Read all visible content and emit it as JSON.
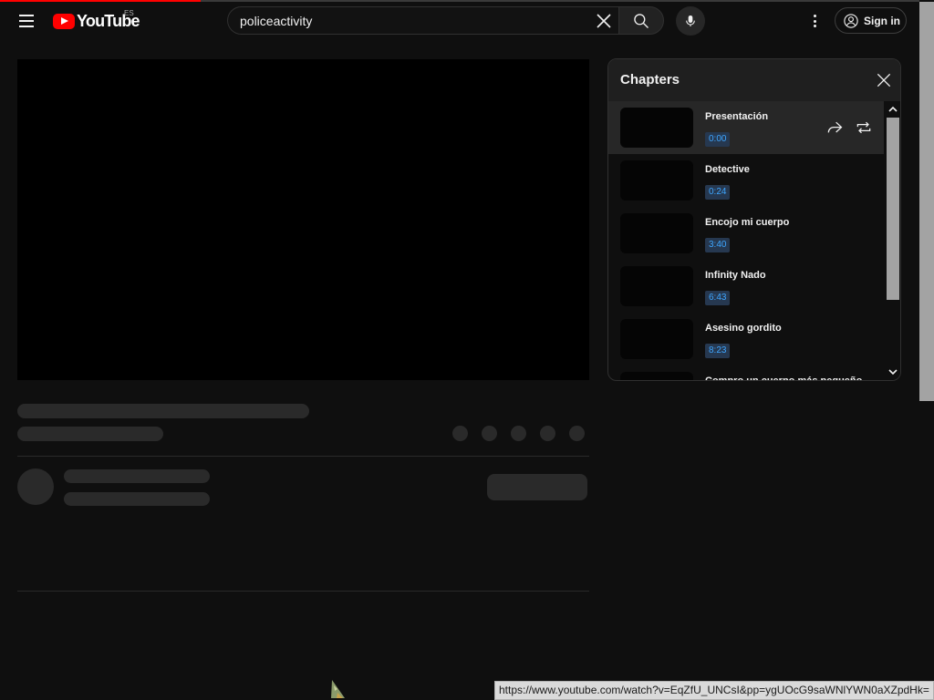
{
  "header": {
    "logo_text": "YouTube",
    "country_code": "ES",
    "search": {
      "value": "policeactivity",
      "placeholder": "Search"
    },
    "signin_label": "Sign in"
  },
  "progress": {
    "played_fraction": 0.215
  },
  "chapters": {
    "title": "Chapters",
    "items": [
      {
        "title": "Presentación",
        "time": "0:00",
        "active": true
      },
      {
        "title": "Detective",
        "time": "0:24",
        "active": false
      },
      {
        "title": "Encojo mi cuerpo",
        "time": "3:40",
        "active": false
      },
      {
        "title": "Infinity Nado",
        "time": "6:43",
        "active": false
      },
      {
        "title": "Asesino gordito",
        "time": "8:23",
        "active": false
      },
      {
        "title": "Compro un cuerpo más pequeño",
        "time": "",
        "active": false
      }
    ]
  },
  "status_bar": {
    "url": "https://www.youtube.com/watch?v=EqZfU_UNCsI&pp=ygUOcG9saWNlYWN0aXZpdHk="
  },
  "colors": {
    "accent": "#ff0000",
    "link_blue": "#3ea6ff",
    "background": "#0f0f0f"
  }
}
